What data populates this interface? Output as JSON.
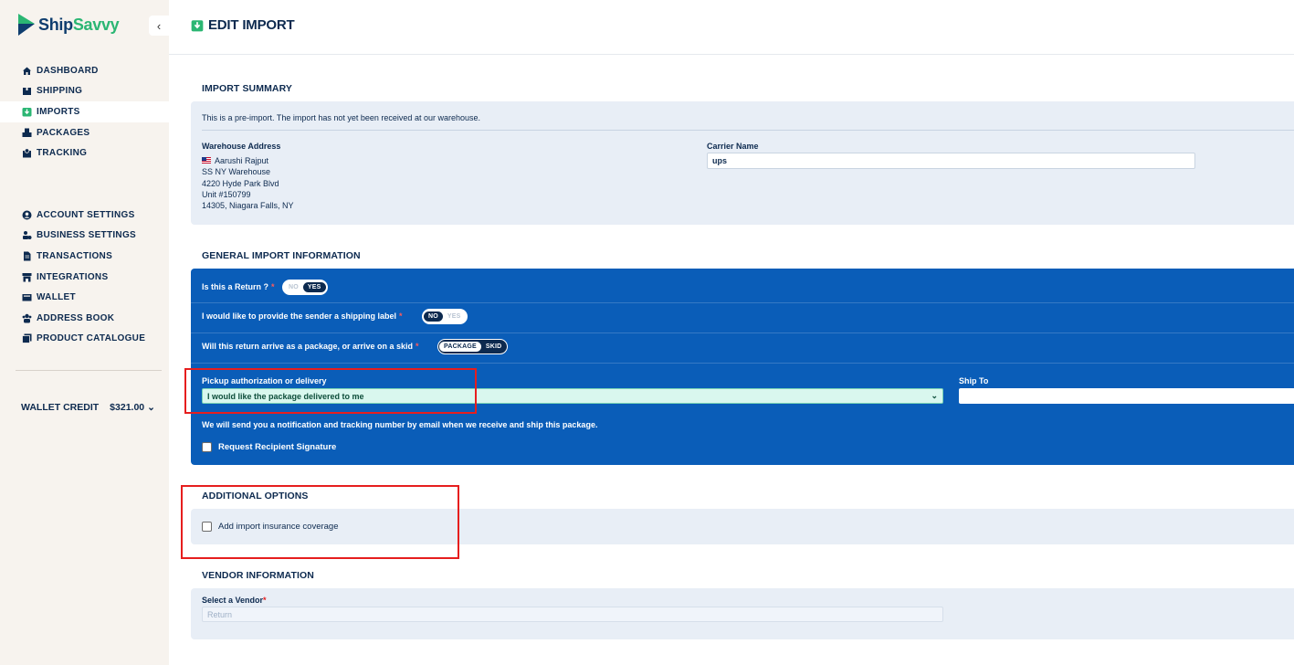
{
  "app": {
    "logo_prefix": "Ship",
    "logo_suffix": "Savvy",
    "collapse_glyph": "‹"
  },
  "sidebar": {
    "primary": [
      {
        "label": "DASHBOARD",
        "icon": "home-icon",
        "active": false
      },
      {
        "label": "SHIPPING",
        "icon": "shipping-box-icon",
        "active": false
      },
      {
        "label": "IMPORTS",
        "icon": "import-icon",
        "active": true
      },
      {
        "label": "PACKAGES",
        "icon": "packages-icon",
        "active": false
      },
      {
        "label": "TRACKING",
        "icon": "tracking-icon",
        "active": false
      }
    ],
    "secondary": [
      {
        "label": "ACCOUNT SETTINGS",
        "icon": "user-circle-icon"
      },
      {
        "label": "BUSINESS SETTINGS",
        "icon": "business-icon"
      },
      {
        "label": "TRANSACTIONS",
        "icon": "document-icon"
      },
      {
        "label": "INTEGRATIONS",
        "icon": "store-icon"
      },
      {
        "label": "WALLET",
        "icon": "wallet-icon"
      },
      {
        "label": "ADDRESS BOOK",
        "icon": "address-book-icon"
      },
      {
        "label": "PRODUCT CATALOGUE",
        "icon": "catalogue-icon"
      }
    ],
    "wallet": {
      "label": "WALLET CREDIT",
      "amount": "$321.00",
      "chevron": "⌄"
    }
  },
  "header": {
    "title": "EDIT IMPORT"
  },
  "import_summary": {
    "title": "IMPORT SUMMARY",
    "note": "This is a pre-import. The import has not yet been received at our warehouse.",
    "warehouse_label": "Warehouse Address",
    "warehouse_lines": [
      "Aarushi Rajput",
      "SS NY Warehouse",
      "4220 Hyde Park Blvd",
      "Unit #150799",
      "14305, Niagara Falls, NY"
    ],
    "carrier_label": "Carrier Name",
    "carrier_value": "ups"
  },
  "general": {
    "title": "GENERAL IMPORT INFORMATION",
    "q_return": "Is this a Return ?",
    "q_return_options": [
      "NO",
      "YES"
    ],
    "q_label": "I would like to provide the sender a shipping label",
    "q_label_options": [
      "NO",
      "YES"
    ],
    "q_skid": "Will this return arrive as a package, or arrive on a skid",
    "q_skid_options": [
      "PACKAGE",
      "SKID"
    ],
    "required_mark": "*",
    "pickup_label": "Pickup authorization or delivery",
    "pickup_value": "I would like the package delivered to me",
    "pickup_chevron": "⌄",
    "shipto_label": "Ship To",
    "notify": "We will send you a notification and tracking number by email when we receive and ship this package.",
    "signature_label": "Request Recipient Signature"
  },
  "additional": {
    "title": "ADDITIONAL OPTIONS",
    "insurance_label": "Add import insurance coverage"
  },
  "vendor": {
    "title": "VENDOR INFORMATION",
    "select_label": "Select a Vendor",
    "required_mark": "*",
    "select_value": "Return"
  },
  "colors": {
    "brand_navy": "#0d2a4f",
    "brand_green": "#2bb673",
    "panel_blue": "#0a5db8",
    "panel_light": "#e8eef6",
    "highlight_red": "#e61e1e"
  }
}
